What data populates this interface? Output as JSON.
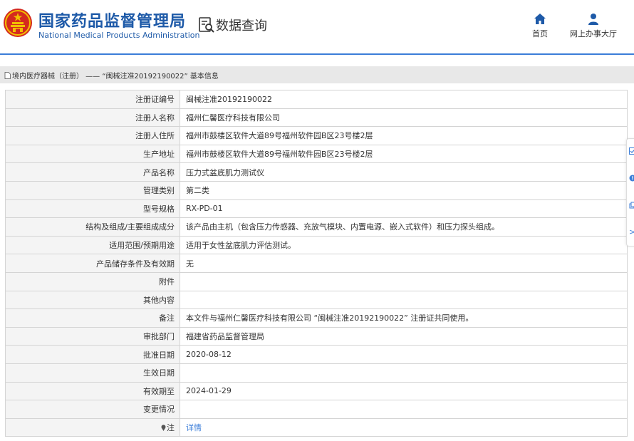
{
  "header": {
    "agency_name_cn": "国家药品监督管理局",
    "agency_name_en": "National Medical Products Administration",
    "section_title": "数据查询",
    "nav": {
      "home": "首页",
      "online_office": "网上办事大厅"
    }
  },
  "breadcrumb": {
    "text": "境内医疗器械（注册） —— “闽械注准20192190022” 基本信息"
  },
  "record": {
    "rows": [
      {
        "label": "注册证编号",
        "value": "闽械注准20192190022"
      },
      {
        "label": "注册人名称",
        "value": "福州仁馨医疗科技有限公司"
      },
      {
        "label": "注册人住所",
        "value": "福州市鼓楼区软件大道89号福州软件园B区23号楼2层"
      },
      {
        "label": "生产地址",
        "value": "福州市鼓楼区软件大道89号福州软件园B区23号楼2层"
      },
      {
        "label": "产品名称",
        "value": "压力式盆底肌力测试仪"
      },
      {
        "label": "管理类别",
        "value": "第二类"
      },
      {
        "label": "型号规格",
        "value": "RX-PD-01"
      },
      {
        "label": "结构及组成/主要组成成分",
        "value": "该产品由主机（包含压力传感器、充放气模块、内置电源、嵌入式软件）和压力探头组成。"
      },
      {
        "label": "适用范围/预期用途",
        "value": "适用于女性盆底肌力评估测试。"
      },
      {
        "label": "产品储存条件及有效期",
        "value": "无"
      },
      {
        "label": "附件",
        "value": ""
      },
      {
        "label": "其他内容",
        "value": ""
      },
      {
        "label": "备注",
        "value": "本文件与福州仁馨医疗科技有限公司 “闽械注准20192190022” 注册证共同使用。"
      },
      {
        "label": "审批部门",
        "value": "福建省药品监督管理局"
      },
      {
        "label": "批准日期",
        "value": "2020-08-12"
      },
      {
        "label": "生效日期",
        "value": ""
      },
      {
        "label": "有效期至",
        "value": "2024-01-29"
      },
      {
        "label": "变更情况",
        "value": ""
      }
    ],
    "note": {
      "label": "注",
      "link_text": "详情"
    }
  },
  "side_float": {
    "icons": [
      "checkbox-icon",
      "help-icon",
      "share-icon",
      "collapse-icon"
    ],
    "collapse_glyph": ">"
  },
  "colors": {
    "brand_blue": "#1E5AA8",
    "link_blue": "#3B7DD8",
    "emblem_red": "#D42A1E",
    "emblem_gold": "#F2C000"
  }
}
